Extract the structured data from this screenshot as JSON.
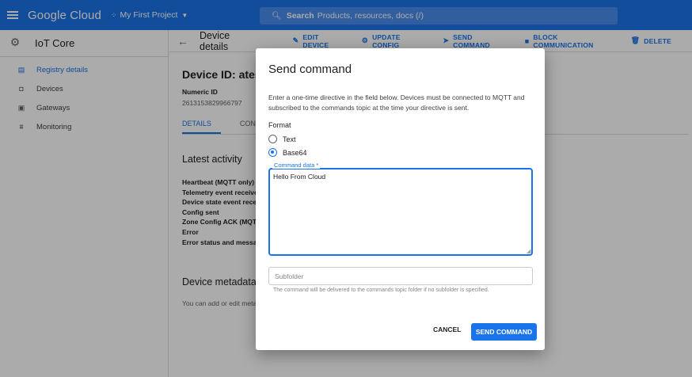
{
  "header": {
    "brand": "Google Cloud",
    "project": "My First Project",
    "search_label": "Search",
    "search_placeholder": "Products, resources, docs (/)"
  },
  "sidebar": {
    "title": "IoT Core",
    "items": [
      {
        "label": "Registry details",
        "icon": "registry-icon",
        "active": true
      },
      {
        "label": "Devices",
        "icon": "device-icon"
      },
      {
        "label": "Gateways",
        "icon": "gateway-icon"
      },
      {
        "label": "Monitoring",
        "icon": "monitoring-icon"
      }
    ]
  },
  "main": {
    "title": "Device details",
    "actions": [
      {
        "label": "EDIT DEVICE",
        "icon": "pencil-icon"
      },
      {
        "label": "UPDATE CONFIG",
        "icon": "gear-icon"
      },
      {
        "label": "SEND COMMAND",
        "icon": "send-icon"
      },
      {
        "label": "BLOCK COMMUNICATION",
        "icon": "block-icon"
      },
      {
        "label": "DELETE",
        "icon": "trash-icon"
      }
    ],
    "device_id": "Device ID: atest-",
    "numeric_id_label": "Numeric ID",
    "numeric_id_value": "2613153829966797",
    "tabs": [
      "DETAILS",
      "CONFIG"
    ],
    "latest_activity_title": "Latest activity",
    "activity_rows": [
      "Heartbeat (MQTT only)",
      "Telemetry event received",
      "Device state event receiv",
      "Config sent",
      "Zone Config ACK (MQTT",
      "Error",
      "Error status and messag"
    ],
    "metadata_title": "Device metadata",
    "metadata_text": "You can add or edit meta"
  },
  "dialog": {
    "title": "Send command",
    "description": "Enter a one-time directive in the field below. Devices must be connected to MQTT and subscribed to the commands topic at the time your directive is sent.",
    "format_label": "Format",
    "format_options": [
      "Text",
      "Base64"
    ],
    "format_selected": "Base64",
    "command_label": "Command data *",
    "command_value": "Hello From Cloud",
    "subfolder_placeholder": "Subfolder",
    "subfolder_hint": "The command will be delivered to the commands topic folder if no subfolder is specified.",
    "cancel_label": "CANCEL",
    "send_label": "SEND COMMAND"
  },
  "colors": {
    "accent": "#1a73e8",
    "topbar": "#1a73e8"
  }
}
